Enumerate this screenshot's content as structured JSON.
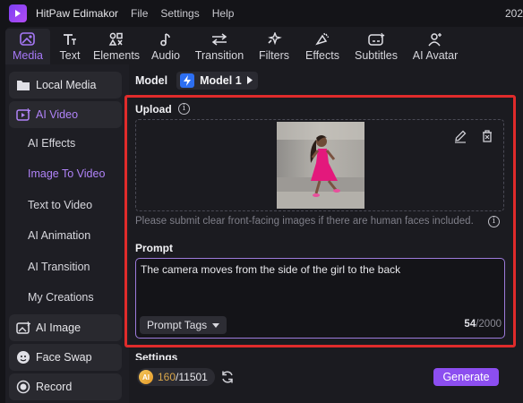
{
  "app": {
    "title": "HitPaw Edimakor",
    "menu": [
      "File",
      "Settings",
      "Help"
    ],
    "right_text": "202"
  },
  "toolbar": {
    "tabs": [
      {
        "label": "Media",
        "icon": "media-icon",
        "active": true
      },
      {
        "label": "Text",
        "icon": "text-icon"
      },
      {
        "label": "Elements",
        "icon": "elements-icon"
      },
      {
        "label": "Audio",
        "icon": "audio-icon"
      },
      {
        "label": "Transition",
        "icon": "transition-icon"
      },
      {
        "label": "Filters",
        "icon": "filters-icon"
      },
      {
        "label": "Effects",
        "icon": "effects-icon"
      },
      {
        "label": "Subtitles",
        "icon": "subtitles-icon"
      },
      {
        "label": "AI Avatar",
        "icon": "ai-avatar-icon"
      }
    ]
  },
  "sidebar": {
    "local_media": "Local Media",
    "ai_video": "AI Video",
    "sub_items": [
      "AI Effects",
      "Image To Video",
      "Text to Video",
      "AI Animation",
      "AI Transition",
      "My Creations"
    ],
    "active_sub": "Image To Video",
    "ai_image": "AI Image",
    "face_swap": "Face Swap",
    "record": "Record"
  },
  "model": {
    "label": "Model",
    "value": "Model 1"
  },
  "upload": {
    "title": "Upload",
    "hint": "Please submit clear front-facing images if there are human faces included."
  },
  "prompt": {
    "title": "Prompt",
    "text": "The camera moves from the side of the girl to the back",
    "tags_label": "Prompt Tags",
    "count": "54",
    "max": "/2000"
  },
  "settings": {
    "title": "Settings"
  },
  "footer": {
    "credits_used": "160",
    "credits_total": "/11501",
    "generate_label": "Generate"
  },
  "colors": {
    "accent": "#8c4ef0",
    "highlight": "#e02b2b"
  }
}
